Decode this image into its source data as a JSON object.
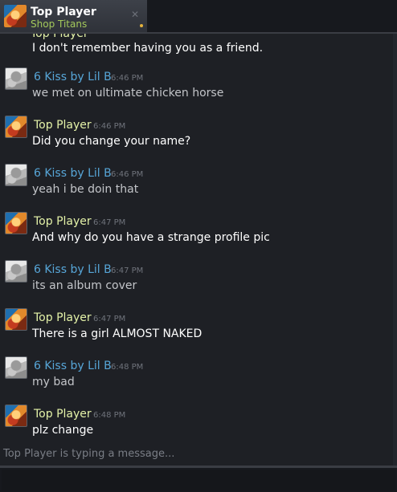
{
  "tab": {
    "name": "Top Player",
    "game": "Shop Titans",
    "close_glyph": "✕",
    "avatar_icon": "player-avatar-icon"
  },
  "messages": [
    {
      "kind": "partial",
      "sender": "Top Player",
      "text": "I don't remember having you as a friend."
    },
    {
      "kind": "lil",
      "sender": "6 Kiss by Lil B",
      "time": "6:46 PM",
      "text": "we met on ultimate chicken horse"
    },
    {
      "kind": "top",
      "sender": "Top Player",
      "time": "6:46 PM",
      "text": "Did you change your name?"
    },
    {
      "kind": "lil",
      "sender": "6 Kiss by Lil B",
      "time": "6:46 PM",
      "text": "yeah i be doin that"
    },
    {
      "kind": "top",
      "sender": "Top Player",
      "time": "6:47 PM",
      "text": "And why do you have a strange profile pic"
    },
    {
      "kind": "lil",
      "sender": "6 Kiss by Lil B",
      "time": "6:47 PM",
      "text": "its an album cover"
    },
    {
      "kind": "top",
      "sender": "Top Player",
      "time": "6:47 PM",
      "text": "There is a girl ALMOST NAKED"
    },
    {
      "kind": "lil",
      "sender": "6 Kiss by Lil B",
      "time": "6:48 PM",
      "text": "my bad"
    },
    {
      "kind": "top",
      "sender": "Top Player",
      "time": "6:48 PM",
      "text": "plz change"
    }
  ],
  "typing_status": "Top Player is typing a message...",
  "input": {
    "value": "",
    "placeholder": ""
  },
  "colors": {
    "accent_name_top": "#e4f2a8",
    "accent_name_lil": "#57a6d8",
    "game_status": "#a4c95b",
    "background": "#1e2025"
  }
}
